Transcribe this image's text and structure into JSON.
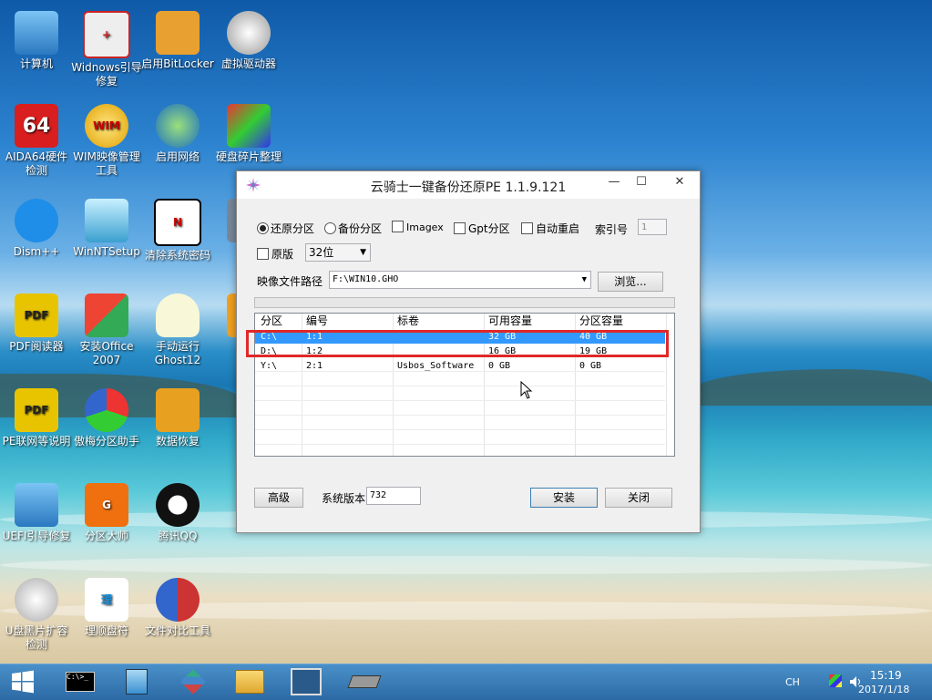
{
  "desktop_icons": [
    {
      "label": "计算机",
      "icon": "computer-icon"
    },
    {
      "label": "Widnows引导修复",
      "icon": "toolbox-icon"
    },
    {
      "label": "启用BitLocker",
      "icon": "key-icon"
    },
    {
      "label": "虚拟驱动器",
      "icon": "disc-drive-icon"
    },
    {
      "label": "AIDA64硬件检测",
      "icon": "aida64-icon"
    },
    {
      "label": "WIM映像管理工具",
      "icon": "wim-icon"
    },
    {
      "label": "启用网络",
      "icon": "globe-icon"
    },
    {
      "label": "硬盘碎片整理",
      "icon": "defrag-icon"
    },
    {
      "label": "Dism++",
      "icon": "gears-icon"
    },
    {
      "label": "WinNTSetup",
      "icon": "setup-icon"
    },
    {
      "label": "清除系统密码",
      "icon": "password-icon"
    },
    {
      "label": "远 A",
      "icon": "remote-icon"
    },
    {
      "label": "PDF阅读器",
      "icon": "pdf-icon"
    },
    {
      "label": "安装Office 2007",
      "icon": "office-icon"
    },
    {
      "label": "手动运行Ghost12",
      "icon": "ghost-icon"
    },
    {
      "label": "云骑",
      "icon": "yunqi-icon"
    },
    {
      "label": "PE联网等说明",
      "icon": "pdf-icon"
    },
    {
      "label": "傲梅分区助手",
      "icon": "partition-assistant-icon"
    },
    {
      "label": "数据恢复",
      "icon": "data-recovery-icon"
    },
    {
      "label": "UEFI引导修复",
      "icon": "uefi-icon"
    },
    {
      "label": "分区大师",
      "icon": "diskgenius-icon"
    },
    {
      "label": "腾讯QQ",
      "icon": "qq-icon"
    },
    {
      "label": "U盘黑片扩容检测",
      "icon": "usb-check-icon"
    },
    {
      "label": "理顺盘符",
      "icon": "drive-letter-icon"
    },
    {
      "label": "文件对比工具",
      "icon": "compare-icon"
    }
  ],
  "window": {
    "title": "云骑士一键备份还原PE 1.1.9.121",
    "min": "—",
    "max": "☐",
    "close": "✕",
    "options": {
      "restore": "还原分区",
      "backup": "备份分区",
      "imagex": "Imagex",
      "gpt": "Gpt分区",
      "auto_restart": "自动重启",
      "index_label": "索引号",
      "index_value": "1",
      "original": "原版",
      "bits": "32位"
    },
    "image_path_label": "映像文件路径",
    "image_path_value": "F:\\WIN10.GHO",
    "browse": "浏览...",
    "table": {
      "headers": [
        "分区",
        "编号",
        "标卷",
        "可用容量",
        "分区容量"
      ],
      "rows": [
        [
          "C:\\",
          "1:1",
          "",
          "32 GB",
          "40 GB"
        ],
        [
          "D:\\",
          "1:2",
          "",
          "16 GB",
          "19 GB"
        ],
        [
          "Y:\\",
          "2:1",
          "Usbos_Software",
          "0 GB",
          "0 GB"
        ]
      ]
    },
    "advanced": "高级",
    "sys_version_label": "系统版本",
    "sys_version_value": "732",
    "install": "安装",
    "close_btn": "关闭"
  },
  "taskbar": {
    "ime": "CH",
    "time": "15:19",
    "date": "2017/1/18"
  },
  "colors": {
    "selection": "#3399ff",
    "highlight_box": "#e02828",
    "taskbar": "#2c6aa5"
  }
}
